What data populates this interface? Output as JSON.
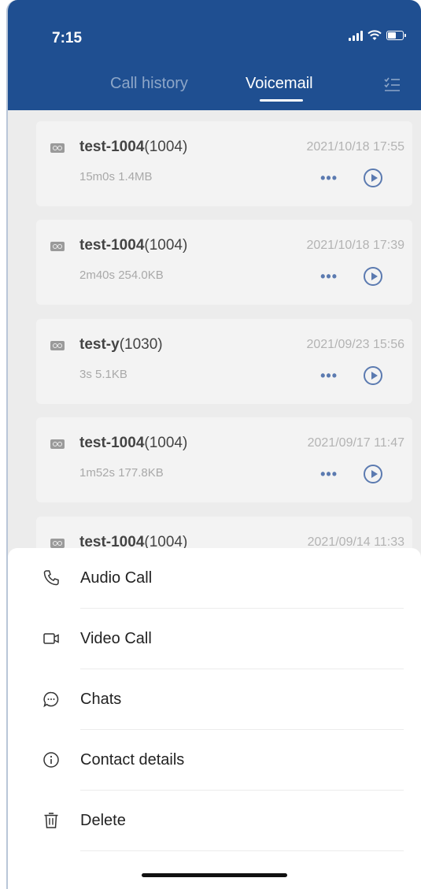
{
  "status": {
    "time": "7:15"
  },
  "tabs": [
    {
      "label": "Call history",
      "active": false
    },
    {
      "label": "Voicemail",
      "active": true
    }
  ],
  "voicemails": [
    {
      "name": "test-1004",
      "ext": "(1004)",
      "meta": "15m0s 1.4MB",
      "date": "2021/10/18 17:55"
    },
    {
      "name": "test-1004",
      "ext": "(1004)",
      "meta": "2m40s 254.0KB",
      "date": "2021/10/18 17:39"
    },
    {
      "name": "test-y",
      "ext": "(1030)",
      "meta": "3s 5.1KB",
      "date": "2021/09/23 15:56"
    },
    {
      "name": "test-1004",
      "ext": "(1004)",
      "meta": "1m52s 177.8KB",
      "date": "2021/09/17 11:47"
    },
    {
      "name": "test-1004",
      "ext": "(1004)",
      "meta": "",
      "date": "2021/09/14 11:33"
    }
  ],
  "more_label": "•••",
  "sheet": {
    "items": [
      {
        "label": "Audio Call",
        "icon": "phone-icon"
      },
      {
        "label": "Video Call",
        "icon": "video-icon"
      },
      {
        "label": "Chats",
        "icon": "chat-icon"
      },
      {
        "label": "Contact details",
        "icon": "info-icon"
      },
      {
        "label": "Delete",
        "icon": "trash-icon"
      }
    ]
  },
  "colors": {
    "header": "#1f4f91",
    "accent": "#5b7ab0"
  }
}
